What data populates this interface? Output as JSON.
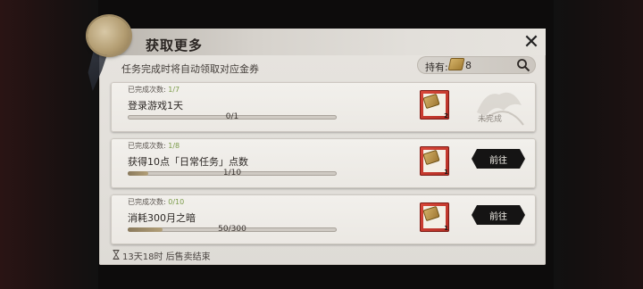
{
  "dialog": {
    "title": "获取更多",
    "subtitle": "任务完成时将自动领取对应金券",
    "holding_label": "持有:",
    "holding_count": "8"
  },
  "tasks": [
    {
      "done_label": "已完成次数:",
      "done_value": "1/7",
      "name": "登录游戏1天",
      "progress_text": "0/1",
      "progress": 0,
      "reward_qty": "2",
      "status_text": "未完成"
    },
    {
      "done_label": "已完成次数:",
      "done_value": "1/8",
      "name": "获得10点「日常任务」点数",
      "progress_text": "1/10",
      "progress": 0.1,
      "reward_qty": "1",
      "button_label": "前往"
    },
    {
      "done_label": "已完成次数:",
      "done_value": "0/10",
      "name": "消耗300月之暗",
      "progress_text": "50/300",
      "progress": 0.1667,
      "reward_qty": "1",
      "button_label": "前往"
    }
  ],
  "footer": {
    "timer_text": "13天18时 后售卖结束"
  },
  "icons": {
    "close": "close-icon",
    "search": "search-icon",
    "hourglass": "hourglass-icon",
    "ticket": "ticket-icon",
    "seal": "wax-seal-icon"
  },
  "colors": {
    "done_count_accent": "#7b9b4a",
    "reward_frame": "#d9473a",
    "goto_button": "#151414"
  }
}
